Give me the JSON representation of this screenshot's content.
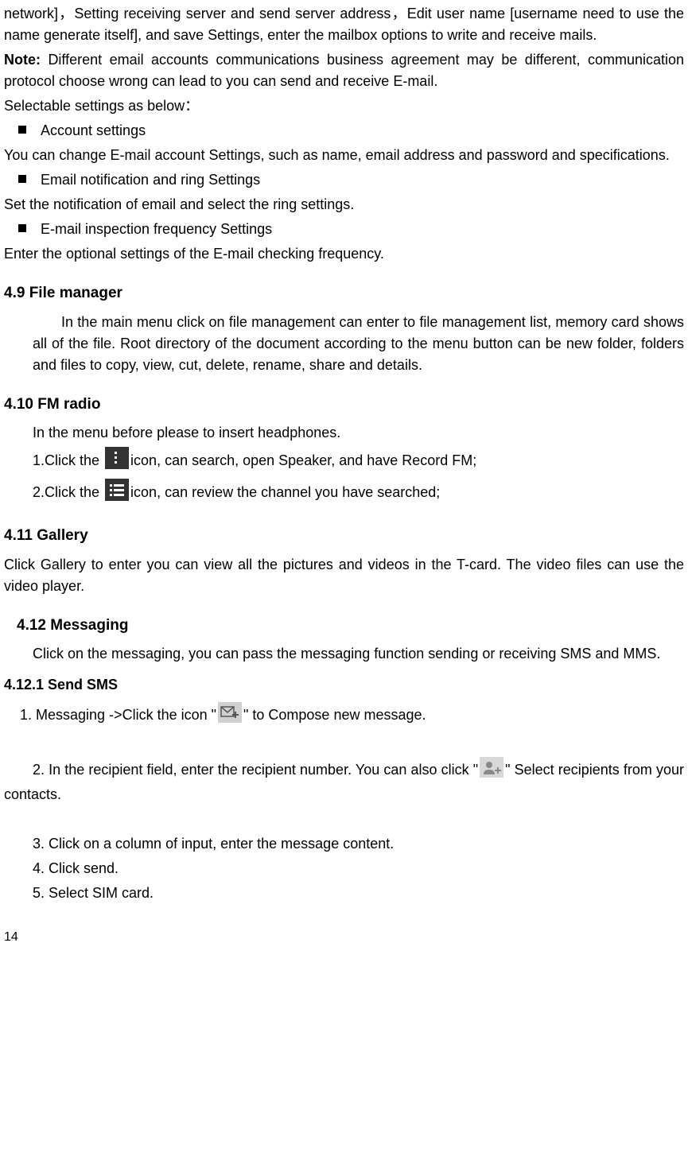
{
  "para1": "network]，Setting receiving server and send server address，Edit user name [username need to use the name generate itself], and save Settings, enter the mailbox options to write and receive mails.",
  "noteLabel": "Note: ",
  "noteBody": "Different email accounts communications business agreement may be different, communication protocol choose wrong can lead to you can send and receive E-mail.",
  "para2": "Selectable settings as below：",
  "bullets": {
    "b1": "Account settings",
    "b1desc": "You can change E-mail account Settings, such as name, email address and password and specifications.",
    "b2": "Email notification and ring Settings",
    "b2desc": "Set the notification of email and select the ring settings.",
    "b3": "E-mail inspection frequency Settings",
    "b3desc": "Enter the optional settings of the E-mail checking frequency."
  },
  "s49": {
    "title": "4.9    File manager",
    "body": "In the main menu click on file management can enter to file management list, memory card shows all of the file. Root directory of the document according to the menu button can be new folder, folders and files to copy, view, cut, delete, rename, share and details."
  },
  "s410": {
    "title": "4.10  FM radio",
    "intro": "In the menu before please to insert headphones.",
    "line1a": "1.Click the ",
    "line1b": "icon, can search, open Speaker, and have Record FM;",
    "line2a": "2.Click the ",
    "line2b": "icon, can review the channel you have searched;"
  },
  "s411": {
    "title": "4.11  Gallery",
    "body": "Click Gallery to enter you can view all the pictures and videos in the T-card. The video files can use the video player."
  },
  "s412": {
    "title": "4.12  Messaging",
    "body": "Click on the messaging, you can pass the messaging function sending or receiving SMS and MMS."
  },
  "s4121": {
    "title": "4.12.1  Send SMS",
    "l1a": "1. Messaging ->Click the icon \"",
    "l1b": "\" to Compose new message.",
    "l2a": "2. In the recipient field, enter the recipient number. You can also click \"",
    "l2b": "\" Select recipients from your contacts.",
    "l3": "3. Click on a column of input, enter the message content.",
    "l4": "4. Click send.",
    "l5": "5. Select SIM card."
  },
  "pageNum": "14"
}
